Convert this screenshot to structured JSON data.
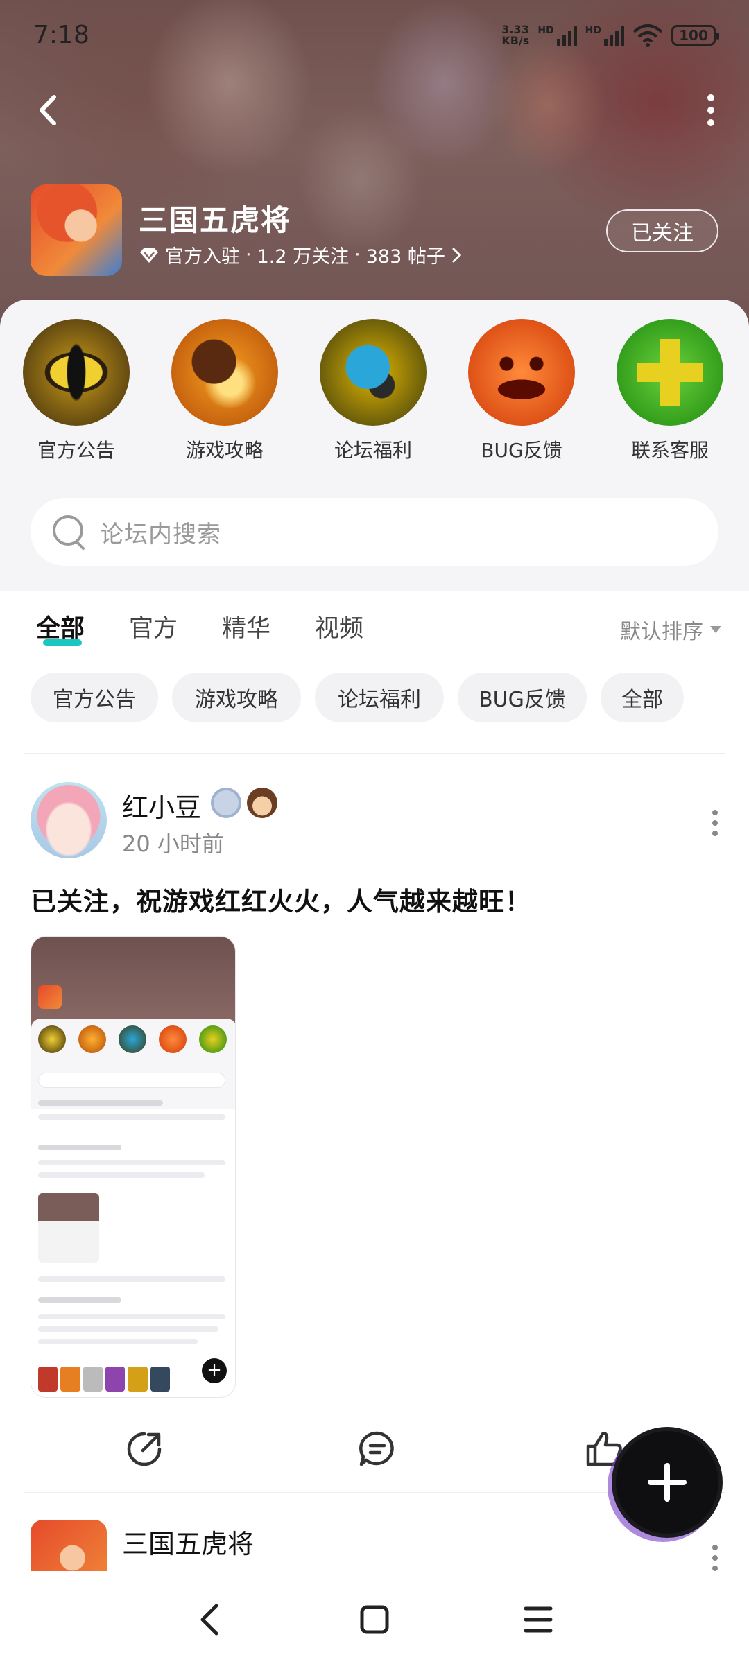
{
  "status_bar": {
    "time": "7:18",
    "net_speed_value": "3.33",
    "net_speed_unit": "KB/s",
    "hd1": "HD",
    "hd2": "HD",
    "battery": "100"
  },
  "header": {
    "title": "三国五虎将",
    "badge_label": "官方入驻",
    "followers": "1.2 万关注",
    "posts": "383 帖子",
    "follow_button": "已关注"
  },
  "quick_links": [
    {
      "label": "官方公告",
      "icon": "eye-icon"
    },
    {
      "label": "游戏攻略",
      "icon": "strategy-icon"
    },
    {
      "label": "论坛福利",
      "icon": "gift-icon"
    },
    {
      "label": "BUG反馈",
      "icon": "pumpkin-icon"
    },
    {
      "label": "联系客服",
      "icon": "plus-cross-icon"
    }
  ],
  "search": {
    "placeholder": "论坛内搜索"
  },
  "tabs": {
    "items": [
      "全部",
      "官方",
      "精华",
      "视频"
    ],
    "active": "全部",
    "sort_label": "默认排序"
  },
  "chips": [
    "官方公告",
    "游戏攻略",
    "论坛福利",
    "BUG反馈",
    "全部"
  ],
  "post": {
    "author": "红小豆",
    "time": "20 小时前",
    "text": "已关注，祝游戏红红火火，人气越来越旺！"
  },
  "post2": {
    "author": "三国五虎将"
  },
  "colors": {
    "accent_tab": "#1ac7c0",
    "fab_bg": "#0f0f12"
  }
}
